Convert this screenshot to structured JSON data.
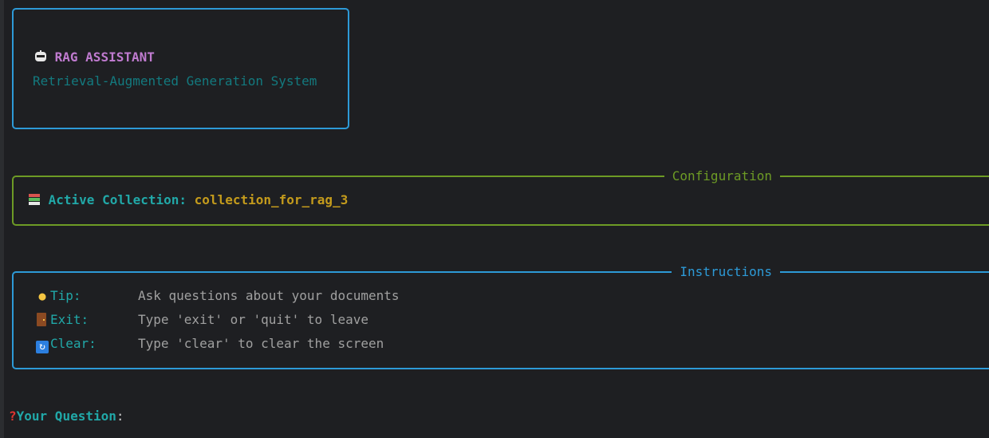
{
  "banner": {
    "icon": "robot-icon",
    "title": "RAG ASSISTANT",
    "subtitle": "Retrieval-Augmented Generation System"
  },
  "config": {
    "title": "Configuration",
    "icon": "books-icon",
    "label": "Active Collection:",
    "value": "collection_for_rag_3"
  },
  "instructions": {
    "title": "Instructions",
    "items": [
      {
        "icon": "lightbulb-icon",
        "label": "Tip:",
        "text": "Ask questions about your documents"
      },
      {
        "icon": "door-icon",
        "label": "Exit:",
        "text": "Type 'exit' or 'quit' to leave"
      },
      {
        "icon": "refresh-icon",
        "label": "Clear:",
        "text": "Type 'clear' to clear the screen"
      }
    ]
  },
  "prompt": {
    "icon": "question-mark-icon",
    "label": "Your Question",
    "suffix": ":"
  },
  "colors": {
    "background": "#1e1f22",
    "blue_border": "#2d9ad7",
    "green_border": "#6d9b25",
    "title_magenta": "#c07bd0",
    "subtitle_teal": "#137a7f",
    "label_cyan": "#21a8a8",
    "value_yellow": "#c49b1c",
    "desc_gray": "#a0a0a0"
  }
}
